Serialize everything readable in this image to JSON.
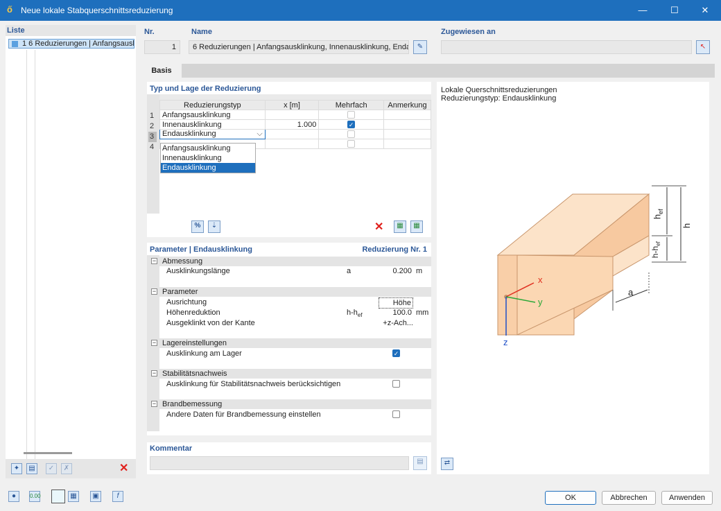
{
  "window": {
    "title": "Neue lokale Stabquerschnittsreduzierung",
    "minimize": "—",
    "maximize": "☐",
    "close": "✕"
  },
  "liste": {
    "title": "Liste",
    "items": [
      {
        "label": "1  6 Reduzierungen | Anfangsausk"
      }
    ]
  },
  "header": {
    "nr_label": "Nr.",
    "nr_value": "1",
    "name_label": "Name",
    "name_value": "6 Reduzierungen | Anfangsausklinkung, Innenausklinkung, Enda",
    "zugewiesen_label": "Zugewiesen an",
    "zugewiesen_value": ""
  },
  "tabs": [
    {
      "label": "Basis"
    }
  ],
  "typ": {
    "title": "Typ und Lage der Reduzierung",
    "columns": [
      "Reduzierungstyp",
      "x [m]",
      "Mehrfach",
      "Anmerkung"
    ],
    "rows": [
      {
        "n": "1",
        "typ": "Anfangsausklinkung",
        "x": "",
        "mehrfach": false
      },
      {
        "n": "2",
        "typ": "Innenausklinkung",
        "x": "1.000",
        "mehrfach": true
      },
      {
        "n": "3",
        "typ": "Endausklinkung",
        "x": "",
        "mehrfach": false
      },
      {
        "n": "4",
        "typ": "",
        "x": "",
        "mehrfach": false
      }
    ],
    "dropdown_options": [
      "Anfangsausklinkung",
      "Innenausklinkung",
      "Endausklinkung"
    ],
    "dropdown_selected": "Endausklinkung"
  },
  "params": {
    "title": "Parameter | Endausklinkung",
    "title_right": "Reduzierung Nr. 1",
    "groups": {
      "abmessung": "Abmessung",
      "parameter": "Parameter",
      "lager": "Lagereinstellungen",
      "stab": "Stabilitätsnachweis",
      "brand": "Brandbemessung"
    },
    "ausklinkungslaenge": {
      "label": "Ausklinkungslänge",
      "sym": "a",
      "value": "0.200",
      "unit": "m"
    },
    "ausrichtung": {
      "label": "Ausrichtung",
      "value": "Höhe"
    },
    "hoehenreduktion": {
      "label": "Höhenreduktion",
      "sym": "h-h",
      "sym_sub": "ef",
      "value": "100.0",
      "unit": "mm"
    },
    "kante": {
      "label": "Ausgeklinkt von der Kante",
      "value": "+z-Ach..."
    },
    "am_lager": {
      "label": "Ausklinkung am Lager",
      "checked": true
    },
    "stab_check": {
      "label": "Ausklinkung für Stabilitätsnachweis berücksichtigen",
      "checked": false
    },
    "brand_check": {
      "label": "Andere Daten für Brandbemessung einstellen",
      "checked": false
    }
  },
  "kommentar": {
    "title": "Kommentar",
    "value": ""
  },
  "preview": {
    "line1": "Lokale Querschnittsreduzierungen",
    "line2": "Reduzierungstyp: Endausklinkung",
    "labels": {
      "hef": "h",
      "hef_sub": "ef",
      "h": "h",
      "hhef": "h-h",
      "hhef_sub": "ef",
      "a": "a",
      "x": "x",
      "y": "y",
      "z": "z"
    }
  },
  "footer": {
    "ok": "OK",
    "abbrechen": "Abbrechen",
    "anwenden": "Anwenden"
  },
  "colors": {
    "accent": "#1e6fbd",
    "beam": "#fbd7b3",
    "beam_edge": "#c8956b"
  }
}
